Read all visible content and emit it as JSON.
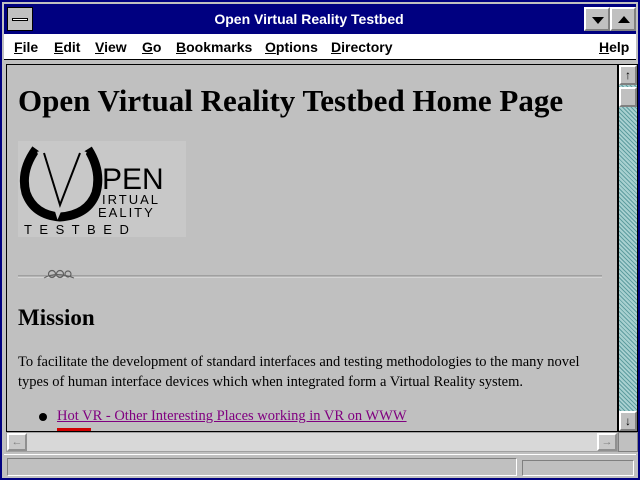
{
  "window": {
    "title": "Open Virtual Reality Testbed"
  },
  "menu": {
    "items": [
      {
        "label": "File"
      },
      {
        "label": "Edit"
      },
      {
        "label": "View"
      },
      {
        "label": "Go"
      },
      {
        "label": "Bookmarks"
      },
      {
        "label": "Options"
      },
      {
        "label": "Directory"
      },
      {
        "label": "Help"
      }
    ]
  },
  "page": {
    "heading": "Open Virtual Reality Testbed Home Page",
    "logo": {
      "word_open": "PEN",
      "word_virtual": "IRTUAL",
      "word_reality": "EALITY",
      "word_testbed": "T E S T B E D"
    },
    "section_heading": "Mission",
    "mission_text": "To facilitate the development of standard interfaces and testing methodologies to the many novel types of human interface devices which when integrated form a Virtual Reality system.",
    "links": [
      {
        "label": "Hot VR - Other Interesting Places working in VR on WWW"
      }
    ]
  },
  "scrollbar": {
    "up_glyph": "↑",
    "down_glyph": "↓",
    "left_glyph": "←",
    "right_glyph": "→"
  },
  "status": {
    "text": ""
  },
  "colors": {
    "titlebar": "#000080",
    "visited_link": "#800080",
    "page_bg": "#c0c0c0"
  }
}
